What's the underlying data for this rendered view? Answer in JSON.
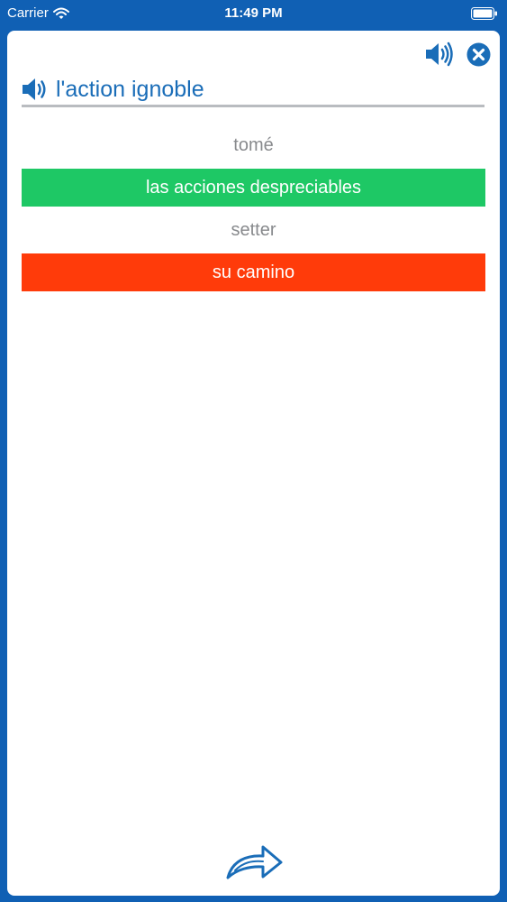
{
  "status_bar": {
    "carrier": "Carrier",
    "time": "11:49 PM",
    "icons": [
      "wifi-icon",
      "battery-icon"
    ]
  },
  "colors": {
    "frame": "#1060b4",
    "accent": "#1a6db8",
    "correct": "#1ec865",
    "wrong": "#ff3b0a",
    "option_text": "#888a8d"
  },
  "toolbar": {
    "icons": [
      "speaker-icon",
      "close-icon"
    ]
  },
  "question": {
    "icon": "speaker-icon",
    "word": "l'action ignoble"
  },
  "options": [
    {
      "label": "tomé",
      "state": "neutral"
    },
    {
      "label": "las acciones despreciables",
      "state": "correct"
    },
    {
      "label": "setter",
      "state": "neutral"
    },
    {
      "label": "su camino",
      "state": "wrong"
    }
  ],
  "footer": {
    "icon": "forward-arrow-icon"
  }
}
